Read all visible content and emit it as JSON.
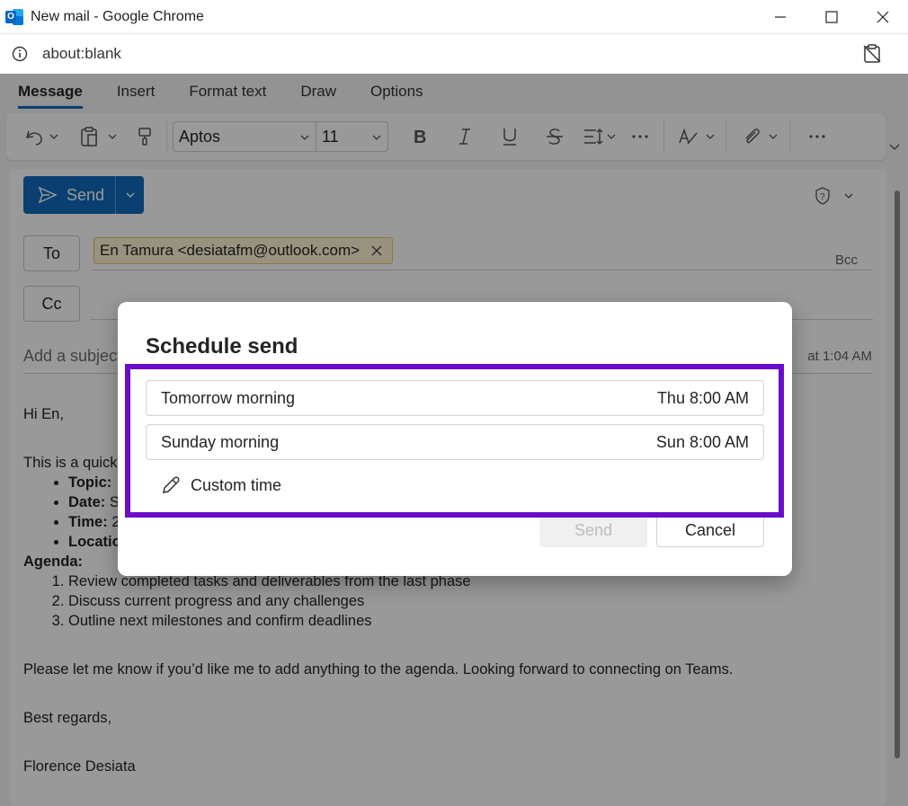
{
  "window": {
    "title": "New mail - Google Chrome"
  },
  "browser": {
    "url": "about:blank"
  },
  "ribbon": {
    "tabs": [
      "Message",
      "Insert",
      "Format text",
      "Draw",
      "Options"
    ],
    "font_name": "Aptos",
    "font_size": "11"
  },
  "compose": {
    "send_label": "Send",
    "to_label": "To",
    "cc_label": "Cc",
    "bcc_label": "Bcc",
    "recipient": "En Tamura <desiatafm@outlook.com>",
    "subject_placeholder": "Add a subject",
    "saved_text": "at 1:04 AM",
    "greeting": "Hi En,",
    "intro": "This is a quick",
    "bullets": [
      "Topic:",
      "Date:",
      "Time:",
      "Location"
    ],
    "bullet_tails": [
      "",
      "S",
      "2",
      ""
    ],
    "agenda_label": "Agenda:",
    "agenda": [
      "Review completed tasks and deliverables from the last phase",
      "Discuss current progress and any challenges",
      "Outline next milestones and confirm deadlines"
    ],
    "closing_line": "Please let me know if you’d like me to add anything to the agenda. Looking forward to connecting on Teams.",
    "sign_off": "Best regards,",
    "signature": "Florence Desiata"
  },
  "dialog": {
    "title": "Schedule send",
    "options": [
      {
        "label": "Tomorrow morning",
        "time": "Thu 8:00 AM"
      },
      {
        "label": "Sunday morning",
        "time": "Sun 8:00 AM"
      }
    ],
    "custom_label": "Custom time",
    "send_label": "Send",
    "cancel_label": "Cancel"
  },
  "colors": {
    "accent": "#0f6cbd",
    "highlight": "#6a0dc9"
  }
}
